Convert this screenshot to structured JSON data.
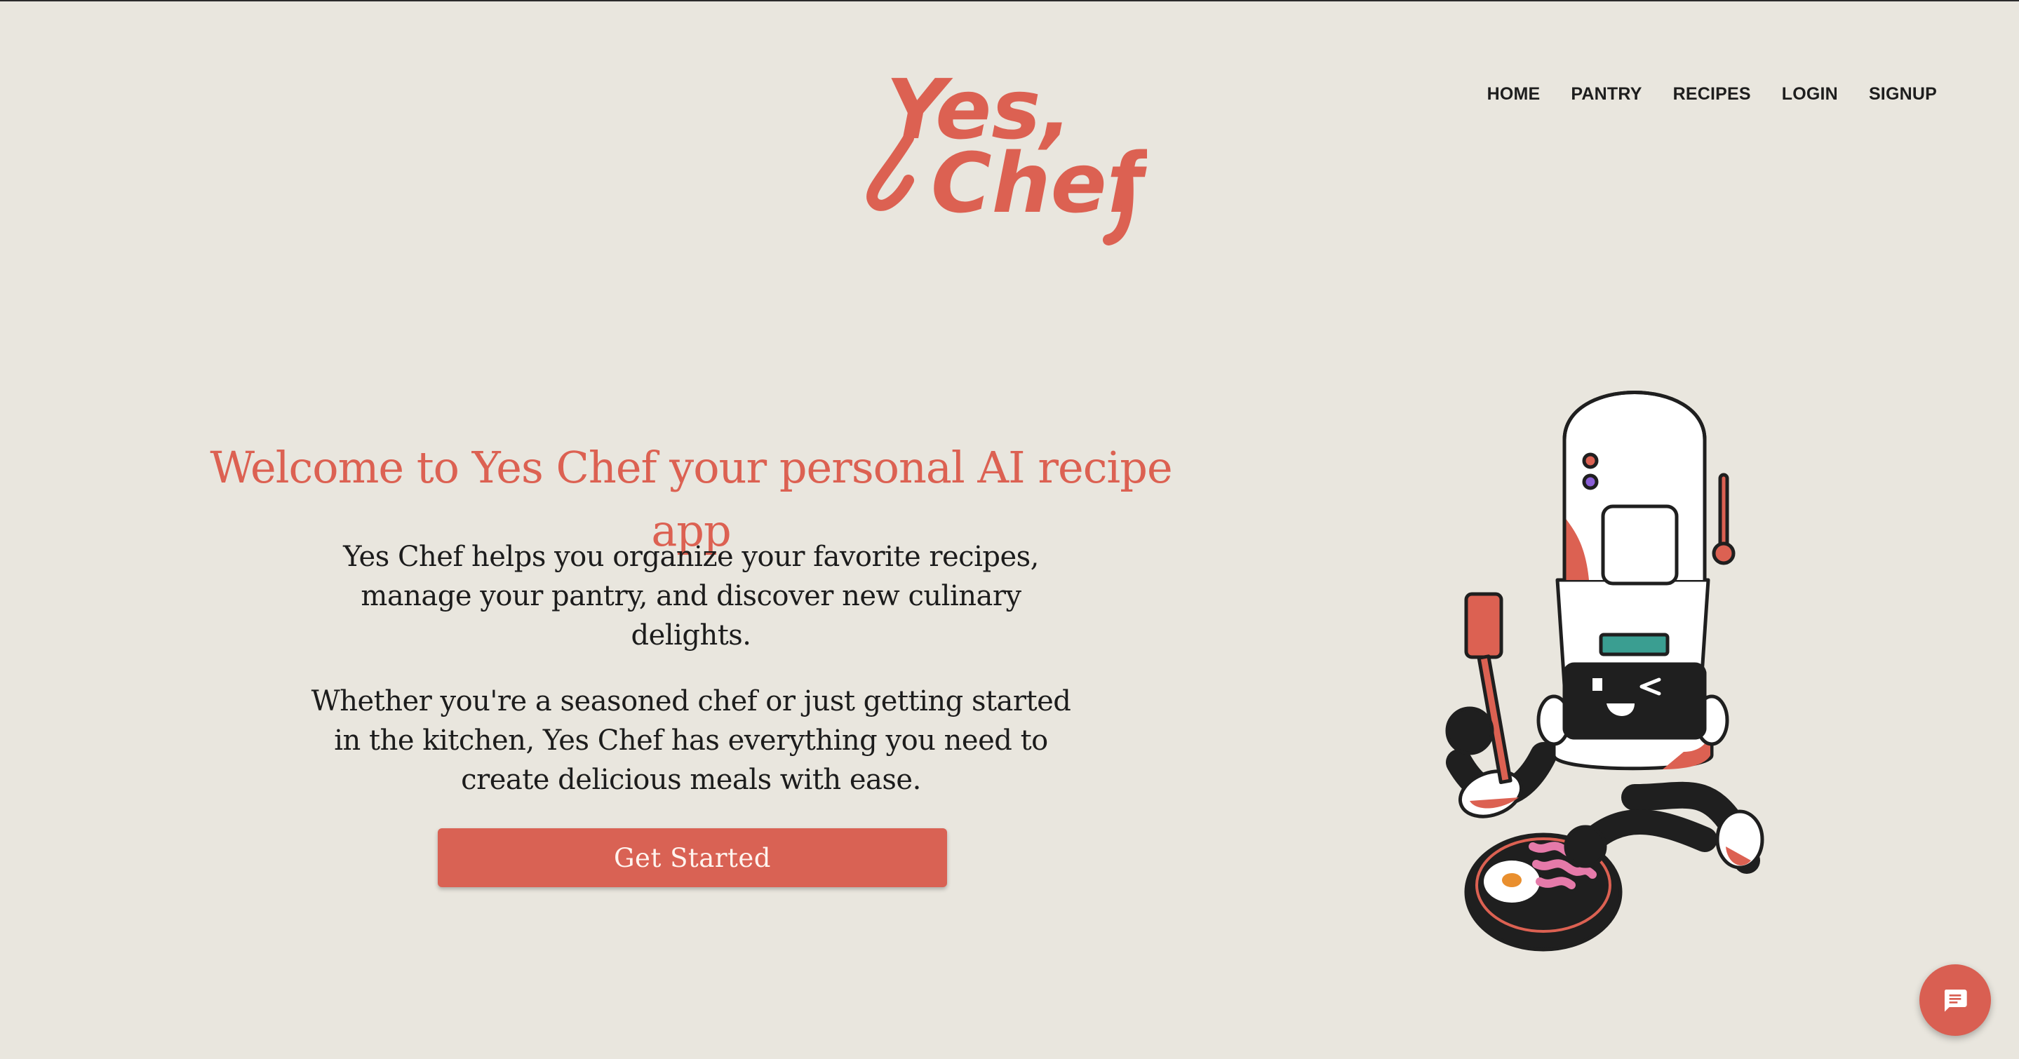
{
  "brand": {
    "logo_text_line1": "Yes,",
    "logo_text_line2": "Chef",
    "accent_color": "#dc6152",
    "background_color": "#e9e6de"
  },
  "nav": {
    "items": [
      {
        "label": "HOME"
      },
      {
        "label": "PANTRY"
      },
      {
        "label": "RECIPES"
      },
      {
        "label": "LOGIN"
      },
      {
        "label": "SIGNUP"
      }
    ]
  },
  "hero": {
    "title": "Welcome to Yes Chef your personal AI recipe app",
    "paragraph1": "Yes Chef helps you organize your favorite recipes, manage your pantry, and discover new culinary delights.",
    "paragraph2": "Whether you're a seasoned chef or just getting started in the kitchen, Yes Chef has everything you need to create delicious meals with ease.",
    "cta_label": "Get Started"
  },
  "illustration": {
    "icon": "robot-chef-cooking-illustration"
  },
  "chat": {
    "icon": "chat-bubble-icon"
  }
}
